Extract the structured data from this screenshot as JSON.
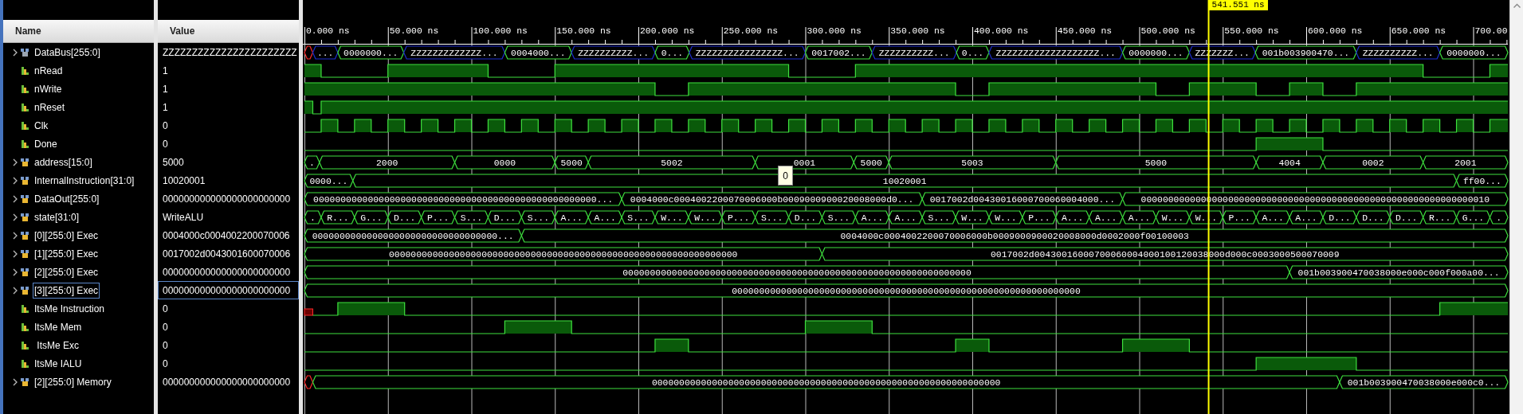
{
  "columns": [
    {
      "label": "Name"
    },
    {
      "label": "Value"
    }
  ],
  "time_axis": {
    "labels": [
      "0.000 ns",
      "50.000 ns",
      "100.000 ns",
      "150.000 ns",
      "200.000 ns",
      "250.000 ns",
      "300.000 ns",
      "350.000 ns",
      "400.000 ns",
      "450.000 ns",
      "500.000 ns",
      "550.000 ns",
      "600.000 ns",
      "650.000 ns",
      "700.00"
    ]
  },
  "cursor": {
    "label": "541.551 ns"
  },
  "tooltip": {
    "text": "0"
  },
  "signals": [
    {
      "name": "DataBus[255:0]",
      "value": "ZZZZZZZZZZZZZZZZZZZZZZZ",
      "kind": "inout",
      "expanded": false,
      "selected": false,
      "segments": [
        {
          "kind": "x"
        },
        {
          "kind": "z",
          "label": "..."
        },
        {
          "kind": "value",
          "label": "0000000..."
        },
        {
          "kind": "z",
          "label": "ZZZZZZZZZZZZZ..."
        },
        {
          "kind": "value",
          "label": "0004000..."
        },
        {
          "kind": "z",
          "label": "ZZZZZZZZZZ..."
        },
        {
          "kind": "value",
          "label": "0..."
        },
        {
          "kind": "z",
          "label": "ZZZZZZZZZZZZZZZZ..."
        },
        {
          "kind": "value",
          "label": "0017002..."
        },
        {
          "kind": "z",
          "label": "ZZZZZZZZZZ..."
        },
        {
          "kind": "value",
          "label": "0..."
        },
        {
          "kind": "z",
          "label": "ZZZZZZZZZZZZZZZZZZZ..."
        },
        {
          "kind": "value",
          "label": "0000000..."
        },
        {
          "kind": "z",
          "label": "ZZZZZZZ..."
        },
        {
          "kind": "value",
          "label": "001b003900470..."
        },
        {
          "kind": "z",
          "label": "ZZZZZZZZZZ..."
        },
        {
          "kind": "value",
          "label": "0000000..."
        }
      ]
    },
    {
      "name": "nRead",
      "value": "1",
      "kind": "bit",
      "selected": false
    },
    {
      "name": "nWrite",
      "value": "1",
      "kind": "bit",
      "selected": false
    },
    {
      "name": "nReset",
      "value": "1",
      "kind": "bit",
      "selected": false
    },
    {
      "name": "Clk",
      "value": "0",
      "kind": "bit",
      "selected": false
    },
    {
      "name": "Done",
      "value": "0",
      "kind": "bit",
      "selected": false
    },
    {
      "name": "address[15:0]",
      "value": "5000",
      "kind": "bus",
      "expanded": false,
      "selected": false,
      "segments": [
        {
          "kind": "value",
          "label": "."
        },
        {
          "kind": "value",
          "label": "2000"
        },
        {
          "kind": "value",
          "label": "0000"
        },
        {
          "kind": "value",
          "label": "5000"
        },
        {
          "kind": "value",
          "label": "5002"
        },
        {
          "kind": "value",
          "label": "0001"
        },
        {
          "kind": "value",
          "label": "5000"
        },
        {
          "kind": "value",
          "label": "5003"
        },
        {
          "kind": "value",
          "label": "5000"
        },
        {
          "kind": "value",
          "label": "4004"
        },
        {
          "kind": "value",
          "label": "0002"
        },
        {
          "kind": "value",
          "label": "2001"
        }
      ]
    },
    {
      "name": "InternalInstruction[31:0]",
      "value": "10020001",
      "kind": "bus",
      "expanded": false,
      "selected": false,
      "segments": [
        {
          "kind": "value",
          "label": "0000..."
        },
        {
          "kind": "value",
          "label": "10020001"
        },
        {
          "kind": "value",
          "label": "ff00..."
        }
      ]
    },
    {
      "name": "DataOut[255:0]",
      "value": "000000000000000000000000",
      "kind": "bus",
      "expanded": false,
      "selected": false,
      "segments": [
        {
          "kind": "value",
          "label": "0000000000000000000000000000000000000000000000000000..."
        },
        {
          "kind": "value",
          "label": "0004000c0004002200070006000b0009000900020008000d0..."
        },
        {
          "kind": "value",
          "label": "0017002d00430016000700060004000..."
        },
        {
          "kind": "value",
          "label": "0000000000000000000000000000000000000000000000000000000000000010"
        }
      ]
    },
    {
      "name": "state[31:0]",
      "value": "WriteALU",
      "kind": "bus",
      "expanded": false,
      "selected": false,
      "segments": [
        {
          "kind": "value",
          "label": "."
        },
        {
          "kind": "value",
          "label": "R..."
        },
        {
          "kind": "value",
          "label": "G..."
        },
        {
          "kind": "value",
          "label": "D..."
        },
        {
          "kind": "value",
          "label": "P..."
        },
        {
          "kind": "value",
          "label": "S..."
        },
        {
          "kind": "value",
          "label": "D..."
        },
        {
          "kind": "value",
          "label": "S..."
        },
        {
          "kind": "value",
          "label": "A..."
        },
        {
          "kind": "value",
          "label": "A..."
        },
        {
          "kind": "value",
          "label": "S..."
        },
        {
          "kind": "value",
          "label": "W..."
        },
        {
          "kind": "value",
          "label": "W..."
        },
        {
          "kind": "value",
          "label": "P..."
        },
        {
          "kind": "value",
          "label": "S..."
        },
        {
          "kind": "value",
          "label": "D..."
        },
        {
          "kind": "value",
          "label": "S..."
        },
        {
          "kind": "value",
          "label": "A..."
        },
        {
          "kind": "value",
          "label": "A..."
        },
        {
          "kind": "value",
          "label": "S..."
        },
        {
          "kind": "value",
          "label": "W..."
        },
        {
          "kind": "value",
          "label": "W..."
        },
        {
          "kind": "value",
          "label": "P..."
        },
        {
          "kind": "value",
          "label": "A..."
        },
        {
          "kind": "value",
          "label": "A..."
        },
        {
          "kind": "value",
          "label": "A..."
        },
        {
          "kind": "value",
          "label": "W..."
        },
        {
          "kind": "value",
          "label": "W..."
        },
        {
          "kind": "value",
          "label": "P..."
        },
        {
          "kind": "value",
          "label": "A..."
        },
        {
          "kind": "value",
          "label": "A..."
        },
        {
          "kind": "value",
          "label": "D..."
        },
        {
          "kind": "value",
          "label": "D..."
        },
        {
          "kind": "value",
          "label": "D..."
        },
        {
          "kind": "value",
          "label": "R..."
        },
        {
          "kind": "value",
          "label": "G..."
        },
        {
          "kind": "value",
          "label": "."
        }
      ]
    },
    {
      "name": "[0][255:0] Exec",
      "value": "0004000c0004002200070006",
      "kind": "bus",
      "expanded": false,
      "selected": false,
      "segments": [
        {
          "kind": "value",
          "label": "0000000000000000000000000000000000..."
        },
        {
          "kind": "value",
          "label": "0004000c0004002200070006000b0009000900020008000d0002000f00100003"
        }
      ]
    },
    {
      "name": "[1][255:0] Exec",
      "value": "0017002d0043001600070006",
      "kind": "bus",
      "expanded": false,
      "selected": false,
      "segments": [
        {
          "kind": "value",
          "label": "0000000000000000000000000000000000000000000000000000000000000000"
        },
        {
          "kind": "value",
          "label": "0017002d00430016000700060004000100120038000d000c0003000500070009"
        }
      ]
    },
    {
      "name": "[2][255:0] Exec",
      "value": "000000000000000000000000",
      "kind": "bus",
      "expanded": false,
      "selected": false,
      "segments": [
        {
          "kind": "value",
          "label": "0000000000000000000000000000000000000000000000000000000000000000"
        },
        {
          "kind": "value",
          "label": "001b003900470038000e000c000f000a00..."
        }
      ]
    },
    {
      "name": "[3][255:0] Exec",
      "value": "000000000000000000000000",
      "kind": "bus",
      "expanded": false,
      "selected": true,
      "segments": [
        {
          "kind": "value",
          "label": "0000000000000000000000000000000000000000000000000000000000000000"
        }
      ]
    },
    {
      "name": "ItsMe Instruction",
      "value": "0",
      "kind": "bit",
      "selected": false
    },
    {
      "name": "ItsMe Mem",
      "value": "0",
      "kind": "bit",
      "selected": false
    },
    {
      "name": " ItsMe Exc",
      "value": "0",
      "kind": "bit",
      "selected": false
    },
    {
      "name": "ItsMe IALU",
      "value": "0",
      "kind": "bit",
      "selected": false
    },
    {
      "name": "[2][255:0] Memory",
      "value": "000000000000000000000000",
      "kind": "bus",
      "expanded": false,
      "selected": false,
      "segments": [
        {
          "kind": "x"
        },
        {
          "kind": "value",
          "label": "0000000000000000000000000000000000000000000000000000000000000000"
        },
        {
          "kind": "value",
          "label": "001b003900470038000e000c0..."
        }
      ]
    }
  ]
}
